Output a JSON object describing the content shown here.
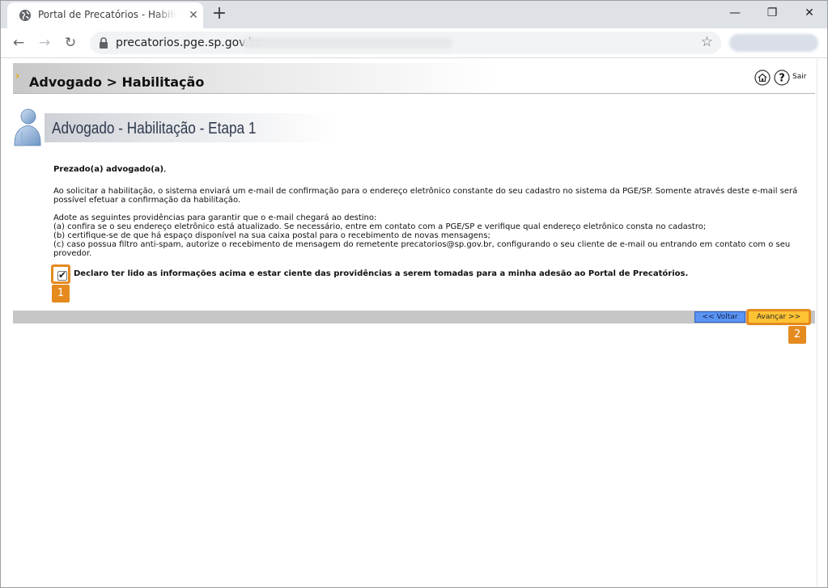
{
  "browser": {
    "tab_title": "Portal de Precatórios - Habilitação",
    "tab_close": "✕",
    "new_tab": "+",
    "url": "precatorios.pge.sp.gov.br",
    "back": "←",
    "forward": "→",
    "reload": "↻",
    "star": "☆",
    "minimize": "—",
    "restore": "❐",
    "close": "✕"
  },
  "header": {
    "breadcrumb": "Advogado > Habilitação",
    "exit_label": "Sair",
    "help_glyph": "?"
  },
  "section": {
    "title": "Advogado - Habilitação - Etapa 1"
  },
  "content": {
    "greeting": "Prezado(a) advogado(a)",
    "greeting_punct": ",",
    "paragraph1": "Ao solicitar a habilitação, o sistema enviará um e-mail de confirmação para o endereço eletrônico constante do seu cadastro no sistema da PGE/SP. Somente através deste e-mail será possível efetuar a confirmação da habilitação.",
    "steps_intro": "Adote as seguintes providências para garantir que o e-mail chegará ao destino:",
    "step_a": "(a) confira se o seu endereço eletrônico está atualizado. Se necessário, entre em contato com a PGE/SP e verifique qual endereço eletrônico consta no cadastro;",
    "step_b": "(b) certifique-se de que há espaço disponível na sua caixa postal para o recebimento de novas mensagens;",
    "step_c": "(c) caso possua filtro anti-spam, autorize o recebimento de mensagem do remetente precatorios@sp.gov.br, configurando o seu cliente de e-mail ou entrando em contato com o seu provedor.",
    "declaration": "Declaro ter lido as informações acima e estar ciente das providências a serem tomadas para a minha adesão ao Portal de Precatórios.",
    "declaration_checked": true,
    "check_glyph": "✔"
  },
  "actions": {
    "back_label": "<< Voltar",
    "next_label": "Avançar >>"
  },
  "annotations": {
    "badge1": "1",
    "badge2": "2",
    "highlight_color": "#e58a1f"
  },
  "colors": {
    "back_button": "#5b94f3",
    "next_button": "#ffc233",
    "action_bar": "#c6c6c6"
  }
}
